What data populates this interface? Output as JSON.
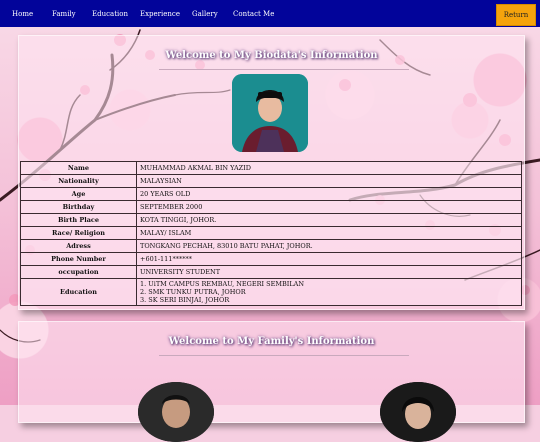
{
  "nav": {
    "items": [
      "Home",
      "Family",
      "Education",
      "Experience",
      "Gallery",
      "Contact Me"
    ],
    "return_label": "Return"
  },
  "biodata": {
    "title": "Welcome to My Biodata's Information",
    "rows": [
      {
        "key": "Name",
        "value": "MUHAMMAD AKMAL BIN YAZID"
      },
      {
        "key": "Nationality",
        "value": "MALAYSIAN"
      },
      {
        "key": "Age",
        "value": "20 YEARS OLD"
      },
      {
        "key": "Birthday",
        "value": "SEPTEMBER 2000"
      },
      {
        "key": "Birth Place",
        "value": "KOTA TINGGI, JOHOR."
      },
      {
        "key": "Race/ Religion",
        "value": "MALAY/ ISLAM"
      },
      {
        "key": "Adress",
        "value": "TONGKANG PECHAH, 83010 BATU PAHAT, JOHOR."
      },
      {
        "key": "Phone Number",
        "value": "+601-111******"
      },
      {
        "key": "occupation",
        "value": "UNIVERSITY STUDENT"
      },
      {
        "key": "Education",
        "value_lines": [
          "1. UiTM CAMPUS REMBAU, NEGERI SEMBILAN",
          "2. SMK TUNKU PUTRA, JOHOR",
          "3. SK SERI BINJAI, JOHOR"
        ]
      }
    ]
  },
  "family": {
    "title": "Welcome to My Family's Information"
  },
  "colors": {
    "nav_bg": "#02049a",
    "return_bg": "#f5a30c",
    "page_bg": "#f6cfe1"
  }
}
